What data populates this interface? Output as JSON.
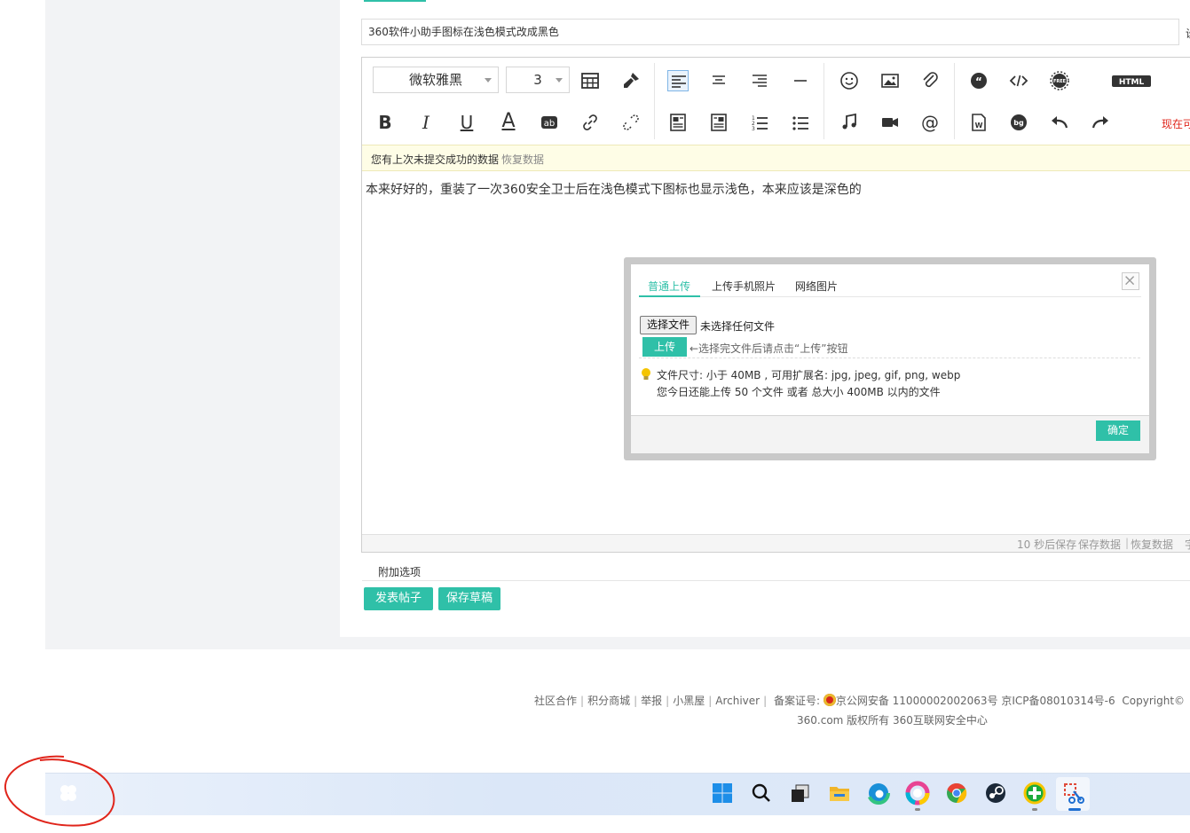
{
  "subject": {
    "value": "360软件小助手图标在浅色模式改成黑色",
    "edge_text": "设"
  },
  "toolbar": {
    "font_family": "微软雅黑",
    "font_size": "3",
    "html_label": "HTML",
    "right_text": "现在可"
  },
  "notice": {
    "text": "您有上次未提交成功的数据",
    "link": "恢复数据"
  },
  "body_text": "本来好好的，重装了一次360安全卫士后在浅色模式下图标也显示浅色，本来应该是深色的",
  "status_bar": {
    "autosave": "10 秒后保存",
    "save": "保存数据",
    "sep": "|",
    "restore": "恢复数据",
    "edge": "字"
  },
  "extra_options": "附加选项",
  "actions": {
    "post": "发表帖子",
    "draft": "保存草稿"
  },
  "dialog": {
    "tabs": [
      "普通上传",
      "上传手机照片",
      "网络图片"
    ],
    "choose_file": "选择文件",
    "no_file": "未选择任何文件",
    "upload": "上传",
    "upload_hint": "←选择完文件后请点击“上传”按钮",
    "info_line1": "文件尺寸: 小于 40MB , 可用扩展名: jpg, jpeg, gif, png, webp",
    "info_line2": "您今日还能上传 50 个文件 或者 总大小 400MB 以内的文件",
    "ok": "确定"
  },
  "footer": {
    "links": [
      "社区合作",
      "积分商城",
      "举报",
      "小黑屋",
      "Archiver"
    ],
    "record_label": "备案证号:",
    "police": "京公网安备 11000002002063号",
    "icp": "京ICP备08010314号-6",
    "copyright": "Copyright©",
    "line2": "360.com 版权所有 360互联网安全中心"
  },
  "taskbar_icons": [
    "360-assistant-icon",
    "windows-start-icon",
    "search-icon",
    "task-view-icon",
    "file-explorer-icon",
    "edge-icon",
    "color-app-icon",
    "chrome-icon",
    "steam-icon",
    "360-security-icon",
    "snipping-tool-icon"
  ],
  "colors": {
    "accent": "#2fc0a8",
    "annotation": "#e0251b"
  }
}
